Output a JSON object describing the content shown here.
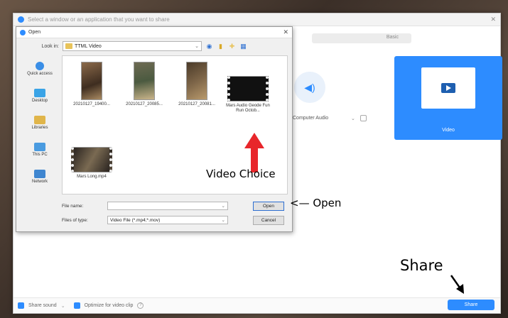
{
  "share_window": {
    "title": "Select a window or an application that you want to share",
    "tab_label": "Basic",
    "computer_audio_label": "Computer Audio",
    "video_tile_label": "Video",
    "bottom_bar": {
      "share_sound": "Share sound",
      "optimize": "Optimize for video clip",
      "share_button": "Share"
    }
  },
  "open_dialog": {
    "title": "Open",
    "look_in_label": "Look in:",
    "look_in_value": "TTML Video",
    "places": [
      "Quick access",
      "Desktop",
      "Libraries",
      "This PC",
      "Network"
    ],
    "files": [
      {
        "name": "20210127_19400..."
      },
      {
        "name": "20210127_20085..."
      },
      {
        "name": "20210127_20081..."
      },
      {
        "name": "Mars Audio Geode Fun Run Octob..."
      },
      {
        "name": "Mars Long.mp4"
      }
    ],
    "file_name_label": "File name:",
    "file_name_value": "",
    "files_of_type_label": "Files of type:",
    "files_of_type_value": "Video File (*.mp4;*.mov)",
    "open_button": "Open",
    "cancel_button": "Cancel"
  },
  "annotations": {
    "video_choice": "Video  Choice",
    "open": "<— Open",
    "share": "Share"
  },
  "colors": {
    "accent": "#2d8cff",
    "arrow_red": "#e8262b"
  },
  "icons": [
    "close-icon",
    "speaker-icon",
    "video-icon",
    "folder-icon",
    "back-icon",
    "up-folder-icon",
    "new-folder-icon",
    "view-menu-icon"
  ]
}
